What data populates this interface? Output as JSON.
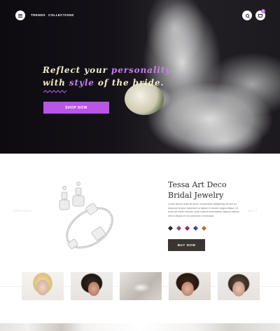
{
  "header": {
    "nav": [
      {
        "label": "TRENDS"
      },
      {
        "label": "COLLECTIONS"
      }
    ],
    "cart_count": "0"
  },
  "hero": {
    "line1_prefix": "Reflect your ",
    "line1_accent": "personality",
    "line2_prefix": "with ",
    "line2_accent": "style",
    "line2_suffix": " of the bride.",
    "cta_label": "SHOP NOW",
    "accent_color": "#b956e6"
  },
  "product": {
    "title_line1": "Tessa Art Deco",
    "title_line2": "Bridal Jewelry",
    "description": "Lorem ipsum dolor sit amet, consectetur adipiscing elit sed do eiusmod tempor incididunt ut labore et dolore magna aliqua. Ut enim ad minim veniam, quis nostrud exercitation ullamco laboris nisi ut aliquip ex ea commodo consequat.",
    "swatches": [
      "#2b2b2b",
      "#7a4a8a",
      "#9a2a4a",
      "#3a4a8a",
      "#a9733a"
    ],
    "buy_label": "BUY NOW",
    "prev_label": "PREVIOUS",
    "next_label": "NEXT"
  },
  "thumbnails": [
    {
      "name": "bride-blonde-headpiece"
    },
    {
      "name": "bride-brunette-tiara"
    },
    {
      "name": "crystal-bracelet"
    },
    {
      "name": "bride-side-comb"
    },
    {
      "name": "bride-forehead-jewel"
    }
  ]
}
